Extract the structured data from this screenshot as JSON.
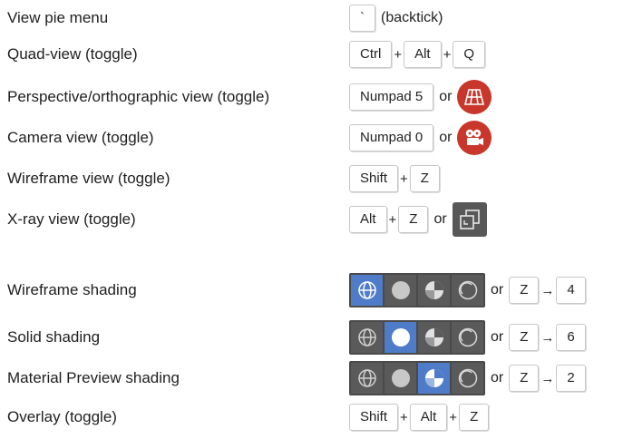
{
  "rows": [
    {
      "label": "View pie menu",
      "key": "`",
      "note": "(backtick)"
    },
    {
      "label": "Quad-view (toggle)",
      "keys": [
        "Ctrl",
        "Alt",
        "Q"
      ]
    },
    {
      "label": "Perspective/orthographic view (toggle)",
      "key": "Numpad 5",
      "or": "or",
      "icon": "grid-perspective-icon"
    },
    {
      "label": "Camera view (toggle)",
      "key": "Numpad 0",
      "or": "or",
      "icon": "camera-icon"
    },
    {
      "label": "Wireframe view (toggle)",
      "keys": [
        "Shift",
        "Z"
      ]
    },
    {
      "label": "X-ray view (toggle)",
      "keys": [
        "Alt",
        "Z"
      ],
      "or": "or",
      "icon": "xray-icon"
    },
    {
      "label": "Wireframe shading",
      "active": 0,
      "or": "or",
      "keys": [
        "Z",
        "4"
      ]
    },
    {
      "label": "Solid shading",
      "active": 1,
      "or": "or",
      "keys": [
        "Z",
        "6"
      ]
    },
    {
      "label": "Material Preview shading",
      "active": 2,
      "or": "or",
      "keys": [
        "Z",
        "2"
      ]
    },
    {
      "label": "Overlay (toggle)",
      "keys": [
        "Shift",
        "Alt",
        "Z"
      ]
    }
  ],
  "symbols": {
    "plus": "+",
    "arrow": "→"
  },
  "colors": {
    "accent": "#4e7cc9",
    "camera_red": "#c9362b"
  }
}
